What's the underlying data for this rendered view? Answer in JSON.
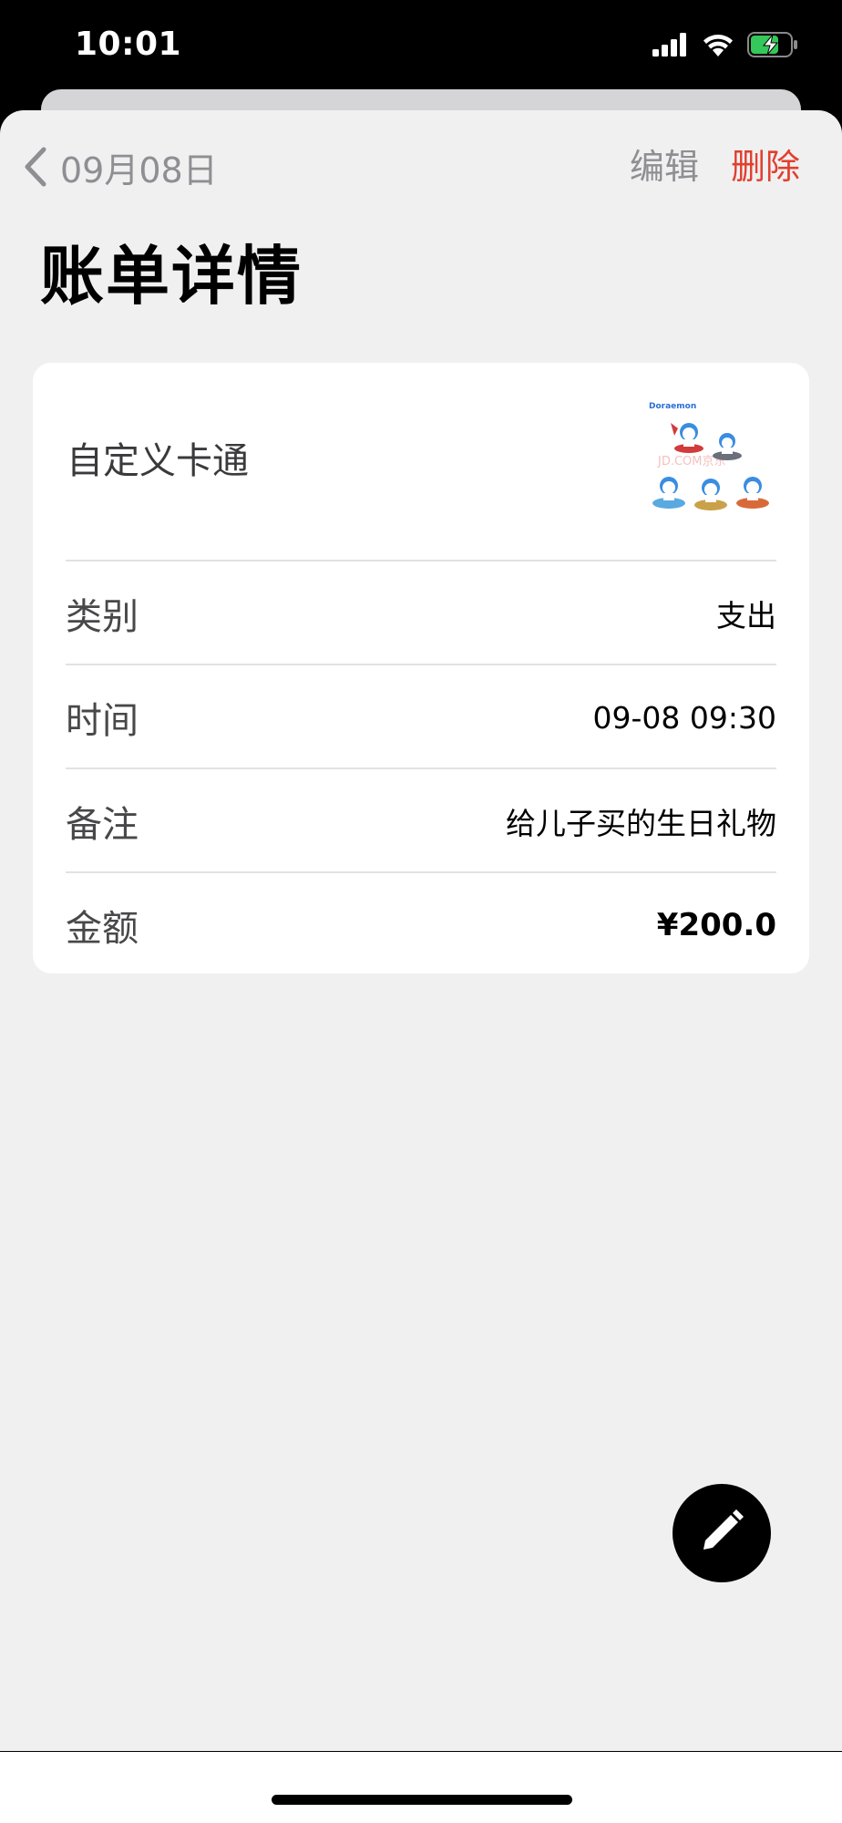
{
  "status_bar": {
    "time": "10:01",
    "icons": [
      "cellular-signal-icon",
      "wifi-icon",
      "battery-charging-icon"
    ]
  },
  "nav": {
    "back_label": "09月08日",
    "edit_label": "编辑",
    "delete_label": "删除"
  },
  "page": {
    "title": "账单详情"
  },
  "bill": {
    "name": "自定义卡通",
    "thumbnail_logo": "Doraemon",
    "thumbnail_watermark": "JD.COM京东",
    "rows": [
      {
        "label": "类别",
        "value": "支出"
      },
      {
        "label": "时间",
        "value": "09-08 09:30"
      },
      {
        "label": "备注",
        "value": "给儿子买的生日礼物"
      },
      {
        "label": "金额",
        "value": "¥200.0"
      }
    ]
  },
  "fab": {
    "icon": "pencil-icon"
  },
  "colors": {
    "background": "#f0f0f0",
    "card": "#ffffff",
    "delete_red": "#e0402f",
    "muted_gray": "#8e8e93",
    "fab": "#000000"
  }
}
